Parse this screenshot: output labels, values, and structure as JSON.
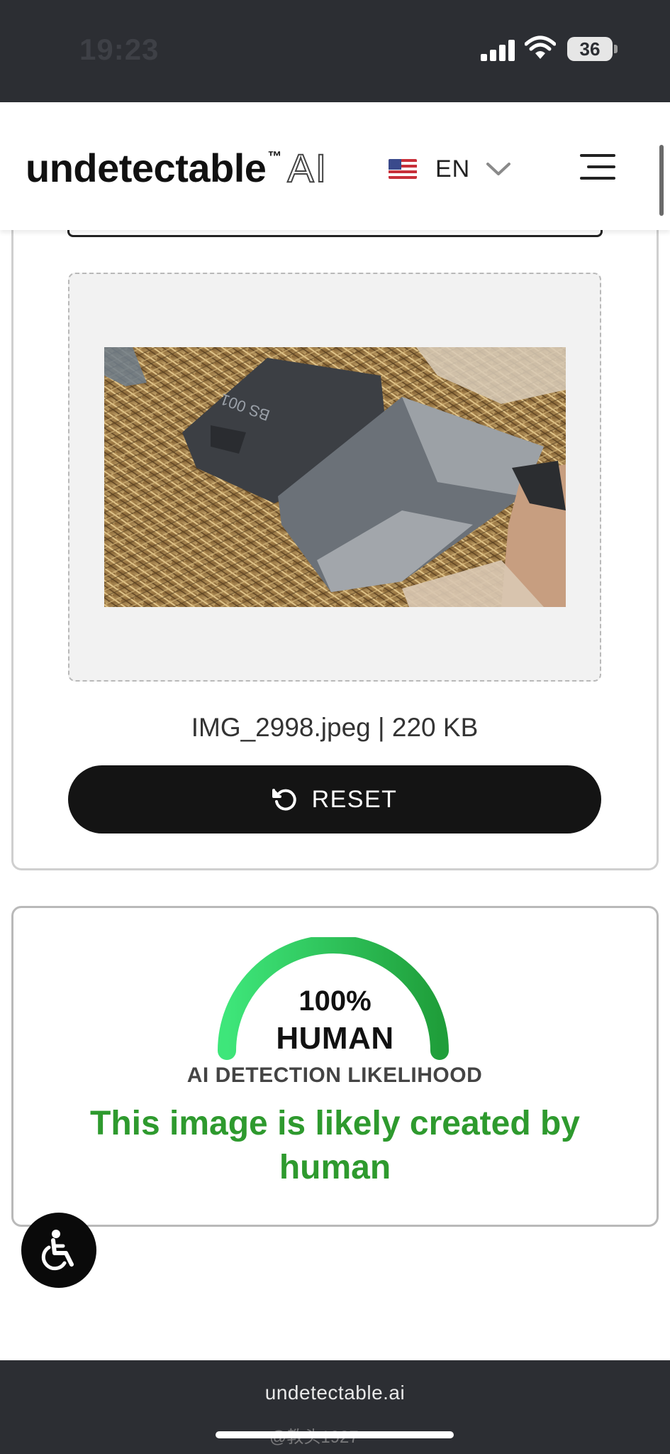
{
  "status_bar": {
    "time": "19:23",
    "battery": "36",
    "background": "#2c2e33"
  },
  "header": {
    "logo_text": "undetectable",
    "logo_tm": "™",
    "logo_ai": "AI",
    "language_code": "EN",
    "flag_icon": "us-flag-icon",
    "menu_icon": "hamburger-menu-icon"
  },
  "upload": {
    "file_info": "IMG_2998.jpeg | 220 KB",
    "reset_label": "RESET",
    "reset_icon": "undo-icon",
    "photo_caption_visible": "BS 001"
  },
  "result": {
    "score": "100%",
    "score_value": 100,
    "classification": "HUMAN",
    "caption": "AI DETECTION LIKELIHOOD",
    "verdict": "This image is likely created by human",
    "gauge_color_start": "#3ee67a",
    "gauge_color_end": "#1f9e3a",
    "verdict_color": "#2e9a2e"
  },
  "accessibility": {
    "icon": "wheelchair-accessibility-icon"
  },
  "browser_bar": {
    "url": "undetectable.ai",
    "watermark": "@教头1927"
  }
}
